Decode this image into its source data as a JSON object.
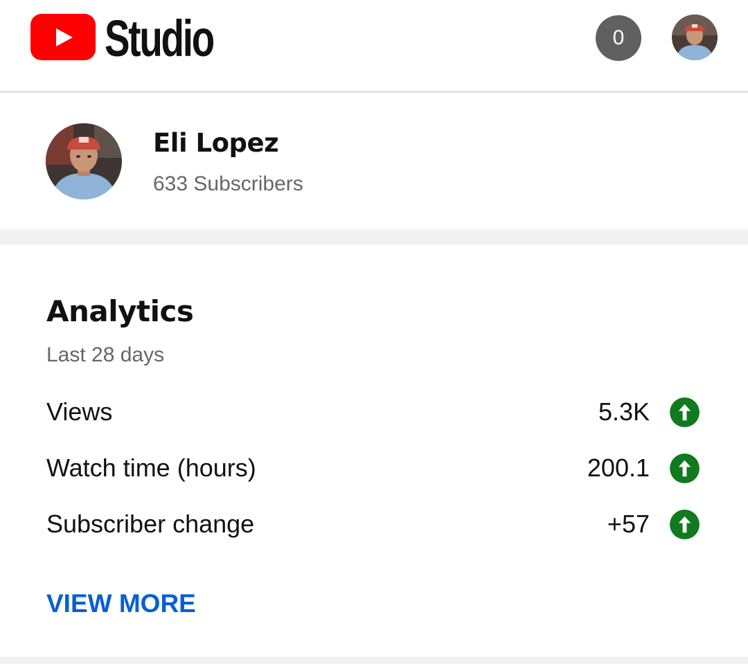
{
  "header": {
    "app_title": "Studio",
    "notification_count": "0",
    "brand_color": "#ff0000"
  },
  "channel": {
    "name": "Eli Lopez",
    "subscribers_text": "633 Subscribers"
  },
  "analytics": {
    "title": "Analytics",
    "period": "Last 28 days",
    "metrics": [
      {
        "label": "Views",
        "value": "5.3K",
        "trend": "up",
        "trend_icon": "arrow-up-circle-icon",
        "trend_color": "#0f7a1e"
      },
      {
        "label": "Watch time (hours)",
        "value": "200.1",
        "trend": "up",
        "trend_icon": "arrow-up-circle-icon",
        "trend_color": "#0f7a1e"
      },
      {
        "label": "Subscriber change",
        "value": "+57",
        "trend": "up",
        "trend_icon": "arrow-up-circle-icon",
        "trend_color": "#0f7a1e"
      }
    ],
    "view_more_label": "VIEW MORE",
    "link_color": "#065fd4"
  }
}
